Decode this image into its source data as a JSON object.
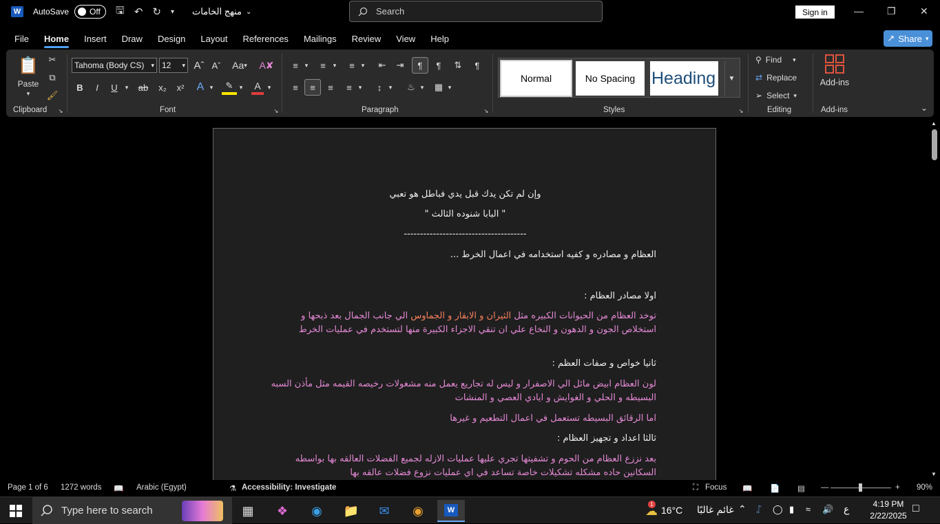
{
  "titlebar": {
    "app_letter": "W",
    "autosave_label": "AutoSave",
    "autosave_state": "Off",
    "doc_title": "منهج الخامات",
    "search_placeholder": "Search",
    "signin_label": "Sign in"
  },
  "menu": {
    "tabs": [
      "File",
      "Home",
      "Insert",
      "Draw",
      "Design",
      "Layout",
      "References",
      "Mailings",
      "Review",
      "View",
      "Help"
    ],
    "active": "Home",
    "share_label": "Share"
  },
  "ribbon": {
    "clipboard": {
      "paste_label": "Paste",
      "group_label": "Clipboard"
    },
    "font": {
      "font_name": "Tahoma (Body CS)",
      "font_size": "12",
      "group_label": "Font",
      "change_case": "Aa",
      "bold": "B",
      "italic": "I",
      "underline": "U",
      "strike": "ab",
      "subscript": "x₂",
      "superscript": "x²"
    },
    "paragraph": {
      "group_label": "Paragraph"
    },
    "styles": {
      "normal": "Normal",
      "no_spacing": "No Spacing",
      "heading": "Heading",
      "group_label": "Styles"
    },
    "editing": {
      "find": "Find",
      "replace": "Replace",
      "select": "Select",
      "group_label": "Editing"
    },
    "addins": {
      "label": "Add-ins",
      "group_label": "Add-ins"
    }
  },
  "document": {
    "line1": "وإن لم تكن يدك قبل يدي فباطل هو تعبي",
    "line2": "\" البابا شنوده الثالث \"",
    "line3": "--------------------------------------",
    "heading1": "العظام و مصادره و كفيه استخدامه في اعمال الخرط ...",
    "h_first": "اولا مصادر العظام :",
    "p1a": "توخد العظام من الحيوانات الكبيره مثل ",
    "p1b": "الثيران و الابقار و الجماوس",
    "p1c": " الي جانب الجمال بعد ذبحها و استخلاص الجون و الدهون و النخاع علي ان تنقي الاجزاء الكبيرة منها لتستخدم في عمليات الخرط",
    "h_second": "ثانيا خواص و صفات العظم :",
    "p2": "لون العظام ابيض مائل الي الاصفرار و ليس له تجاريع يعمل منه مشغولات رخيصه القيمه مثل مأذن السبه البسيطه و الحلي و الغوايش و ايادي العصي و المنشات",
    "p3": "اما الرقائق البسيطه تستعمل في اعمال التطعيم و غيرها",
    "h_third": "ثالثا اعداد و تجهيز العظام :",
    "p4": "بعد نززع العظام من الحوم و تشفيتها تجري عليها عمليات الازله لجميع الفضلات العالقه بها بواسطه السكانين حاده مشكله تشكيلات خاصة تساعد في اي عمليات نزوع فضلات عالقه بها"
  },
  "status": {
    "page": "Page 1 of 6",
    "words": "1272 words",
    "language": "Arabic (Egypt)",
    "accessibility": "Accessibility: Investigate",
    "focus": "Focus",
    "zoom": "90%"
  },
  "taskbar": {
    "search_placeholder": "Type here to search",
    "weather_temp": "16°C",
    "weather_desc": "غائم غالبًا",
    "lang": "ع",
    "time": "4:19 PM",
    "date": "2/22/2025",
    "weather_badge": "1"
  },
  "colors": {
    "accent": "#4ea1f5",
    "share": "#4a90d9",
    "pink": "#e589d6",
    "orange": "#f5815c",
    "word_blue": "#185abd"
  }
}
